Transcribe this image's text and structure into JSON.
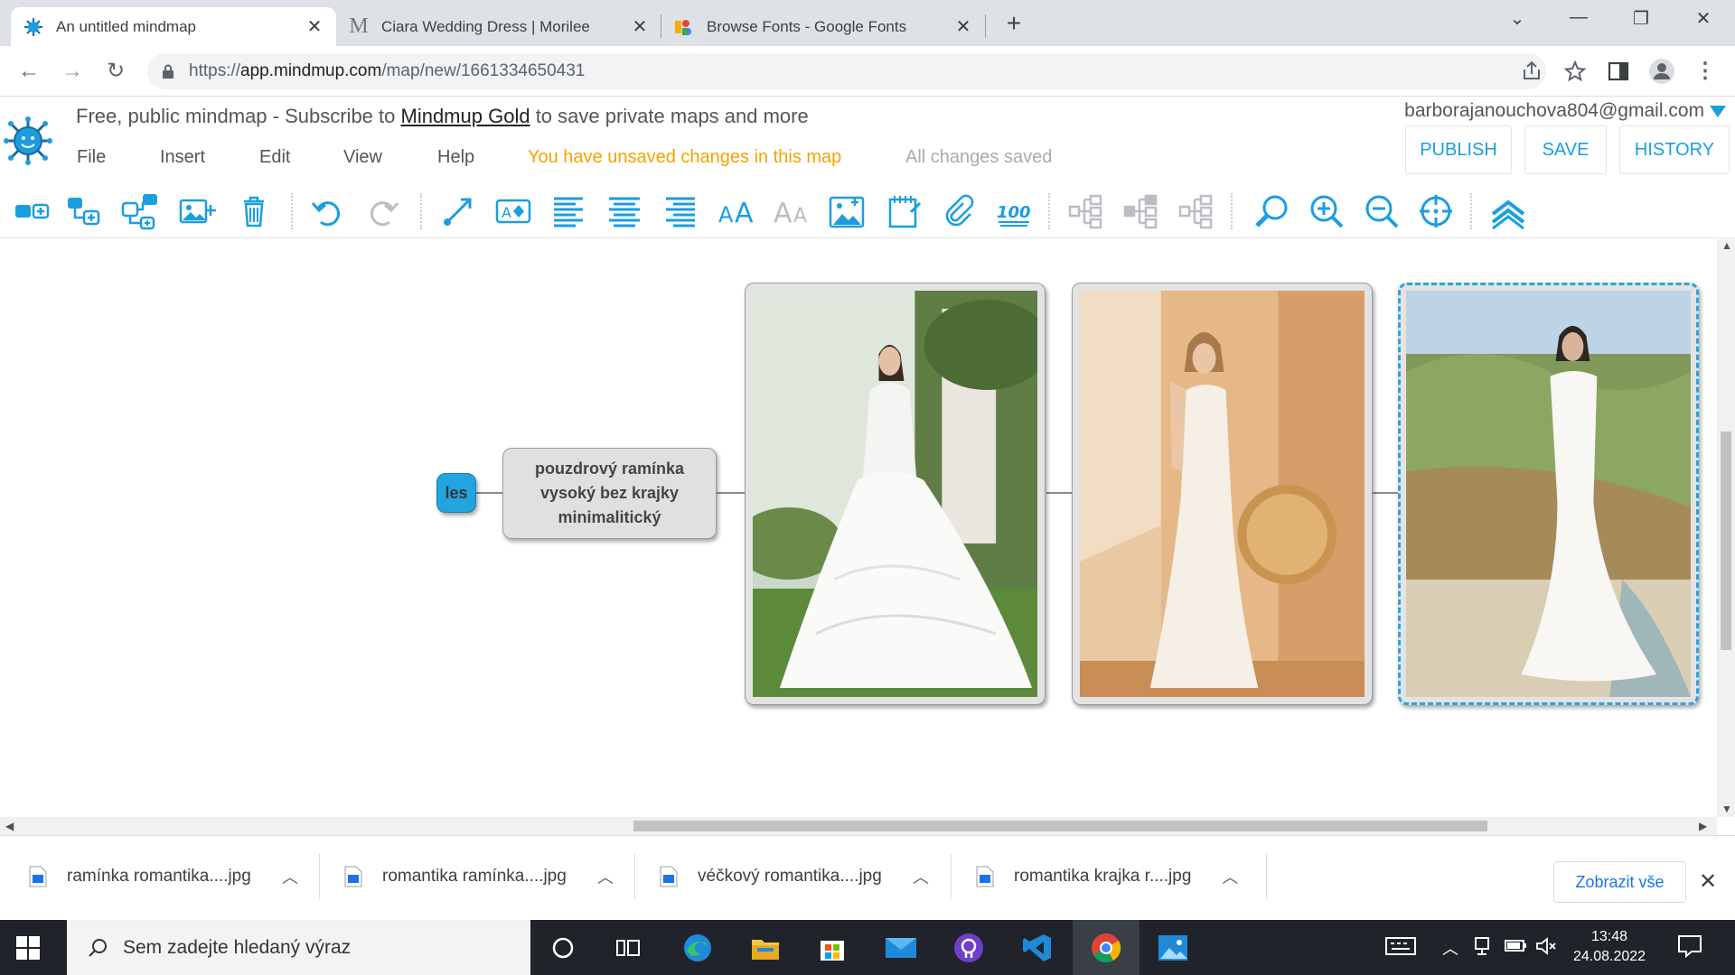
{
  "browser": {
    "tabs": [
      {
        "title": "An untitled mindmap",
        "active": true
      },
      {
        "title": "Ciara Wedding Dress | Morilee",
        "active": false
      },
      {
        "title": "Browse Fonts - Google Fonts",
        "active": false
      }
    ],
    "url_prefix": "https://",
    "url_host": "app.mindmup.com",
    "url_path": "/map/new/1661334650431"
  },
  "header": {
    "promo_before": "Free, public mindmap - Subscribe to ",
    "promo_link": "Mindmup Gold",
    "promo_after": " to save private maps and more",
    "account_email": "barborajanouchova804@gmail.com",
    "menu": [
      "File",
      "Insert",
      "Edit",
      "View",
      "Help"
    ],
    "unsaved_text": "You have unsaved changes in this map",
    "saved_text": "All changes saved",
    "buttons": {
      "publish": "PUBLISH",
      "save": "SAVE",
      "history": "HISTORY"
    }
  },
  "mindmap": {
    "root_label": "les",
    "text_node": "pouzdrový ramínka vysoký bez krajky minimalitický",
    "image_nodes": 3,
    "selected_image_index": 2
  },
  "downloads": {
    "items": [
      "ramínka romantika....jpg",
      "romantika ramínka....jpg",
      "véčkový romantika....jpg",
      "romantika krajka r....jpg"
    ],
    "show_all": "Zobrazit vše"
  },
  "taskbar": {
    "search_placeholder": "Sem zadejte hledaný výraz",
    "time": "13:48",
    "date": "24.08.2022"
  },
  "colors": {
    "accent": "#1a9ee0",
    "unsaved": "#f6a100",
    "root_node": "#22a4e0"
  }
}
